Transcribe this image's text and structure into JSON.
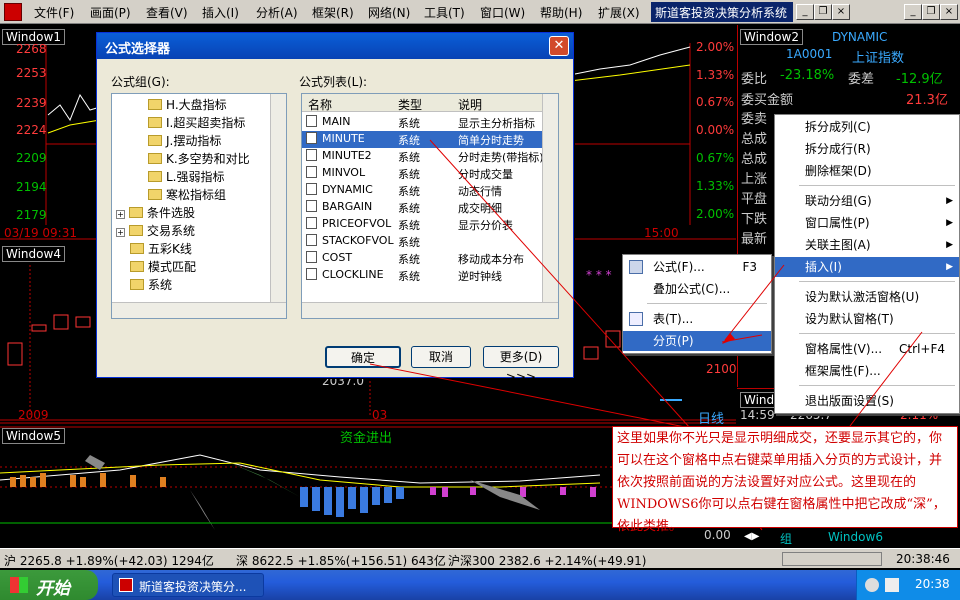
{
  "menubar": {
    "items": [
      "文件(F)",
      "画面(P)",
      "查看(V)",
      "插入(I)",
      "分析(A)",
      "框架(R)",
      "网络(N)",
      "工具(T)",
      "窗口(W)",
      "帮助(H)",
      "扩展(X)"
    ],
    "app_title": "斯道客投资决策分析系统"
  },
  "window1": {
    "label": "Window1",
    "y_left": [
      "2268",
      "2253",
      "2239",
      "2224",
      "2209",
      "2194",
      "2179"
    ],
    "y_right": [
      "2.00%",
      "1.33%",
      "0.67%",
      "0.00%",
      "0.67%",
      "1.33%",
      "2.00%"
    ],
    "time_left": "03/19 09:31",
    "time_right": "15:00"
  },
  "window2": {
    "label": "Window2",
    "title": "DYNAMIC",
    "code": "1A0001",
    "name": "上证指数",
    "row1_a": "委比",
    "row1_b": "-23.18%",
    "row1_c": "委差",
    "row1_d": "-12.9亿",
    "row2_a": "委买金额",
    "row2_b": "21.3亿",
    "row3_a": "委卖",
    "rows": [
      "总成",
      "总成",
      "上涨",
      "平盘",
      "下跌",
      "最新"
    ]
  },
  "window4": {
    "label": "Window4",
    "value1": "2037.0",
    "value2": "2100",
    "date1": "2009",
    "date2": "03",
    "label_right": "日线",
    "side_a": "A股",
    "side_b": "B股"
  },
  "window5": {
    "label": "Window5",
    "title": "资金进出",
    "value": "0.00"
  },
  "window_small": {
    "label": "Window",
    "time": "14:59",
    "value": "2265.7",
    "pct": "2.11%"
  },
  "tabs": [
    "组",
    "Window6"
  ],
  "dialog": {
    "title": "公式选择器",
    "group_label": "公式组(G):",
    "list_label": "公式列表(L):",
    "tree": [
      {
        "text": "H.大盘指标",
        "indent": 2
      },
      {
        "text": "I.超买超卖指标",
        "indent": 2
      },
      {
        "text": "J.摆动指标",
        "indent": 2
      },
      {
        "text": "K.多空势和对比",
        "indent": 2
      },
      {
        "text": "L.强弱指标",
        "indent": 2
      },
      {
        "text": "寒松指标组",
        "indent": 2
      },
      {
        "text": "条件选股",
        "indent": 0,
        "exp": "+"
      },
      {
        "text": "交易系统",
        "indent": 0,
        "exp": "+"
      },
      {
        "text": "五彩K线",
        "indent": 1
      },
      {
        "text": "模式匹配",
        "indent": 1
      },
      {
        "text": "系统",
        "indent": 1
      }
    ],
    "columns": [
      "名称",
      "类型",
      "说明"
    ],
    "rows": [
      [
        "MAIN",
        "系统",
        "显示主分析指标"
      ],
      [
        "MINUTE",
        "系统",
        "简单分时走势"
      ],
      [
        "MINUTE2",
        "系统",
        "分时走势(带指标)"
      ],
      [
        "MINVOL",
        "系统",
        "分时成交量"
      ],
      [
        "DYNAMIC",
        "系统",
        "动态行情"
      ],
      [
        "BARGAIN",
        "系统",
        "成交明细"
      ],
      [
        "PRICEOFVOL",
        "系统",
        "显示分价表"
      ],
      [
        "STACKOFVOL",
        "系统",
        ""
      ],
      [
        "COST",
        "系统",
        "移动成本分布"
      ],
      [
        "CLOCKLINE",
        "系统",
        "逆时钟线"
      ]
    ],
    "ok": "确定",
    "cancel": "取消",
    "more": "更多(D) >>>"
  },
  "ctx_menu": {
    "items": [
      {
        "label": "拆分成列(C)",
        "arrow": false
      },
      {
        "label": "拆分成行(R)",
        "arrow": false
      },
      {
        "label": "删除框架(D)",
        "arrow": false
      },
      {
        "label": "联动分组(G)",
        "arrow": true
      },
      {
        "label": "窗口属性(P)",
        "arrow": true
      },
      {
        "label": "关联主图(A)",
        "arrow": true
      },
      {
        "label": "插入(I)",
        "arrow": true
      },
      {
        "label": "设为默认激活窗格(U)",
        "arrow": false
      },
      {
        "label": "设为默认窗格(T)",
        "arrow": false
      },
      {
        "label": "窗格属性(V)...",
        "shortcut": "Ctrl+F4"
      },
      {
        "label": "框架属性(F)...",
        "arrow": false
      },
      {
        "label": "退出版面设置(S)",
        "arrow": false
      }
    ]
  },
  "sub_menu": {
    "items": [
      {
        "label": "公式(F)...",
        "shortcut": "F3"
      },
      {
        "label": "叠加公式(C)..."
      },
      {
        "label": "表(T)..."
      },
      {
        "label": "分页(P)"
      }
    ]
  },
  "note": "这里如果你不光只是显示明细成交，还要显示其它的，你可以在这个窗格中点右键菜单用插入分页的方式设计，并依次按照前面说的方法设置好对应公式。这里现在的WINDOWS6你可以点右键在窗格属性中把它改成“深”，依此类推。",
  "status": {
    "sh": "沪 2265.8 +1.89%(+42.03) 1294亿",
    "sz": "深 8622.5 +1.85%(+156.51) 643亿",
    "hs": "沪深300 2382.6 +2.14%(+49.91)",
    "time": "20:38:46"
  },
  "taskbar": {
    "start": "开始",
    "task": "斯道客投资决策分...",
    "clock": "20:38"
  }
}
